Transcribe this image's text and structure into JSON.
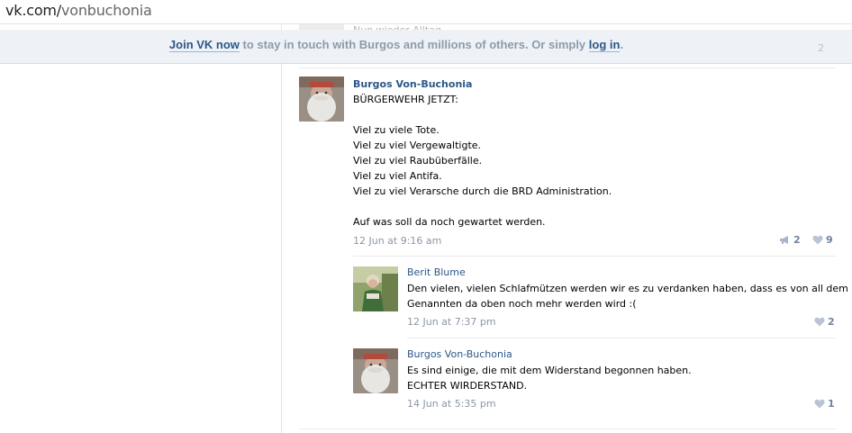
{
  "browser": {
    "url_host": "vk.com/",
    "url_path": "vonbuchonia"
  },
  "ghost_text": "Nun wieder Alltag.",
  "banner": {
    "join_label": "Join VK now",
    "middle_text": " to stay in touch with Burgos and millions of others. Or simply ",
    "login_label": "log in",
    "end_text": "."
  },
  "post": {
    "author": "Burgos Von-Buchonia",
    "text": "BÜRGERWEHR JETZT:\n\nViel zu viele Tote.\nViel zu viel Vergewaltigte.\nViel zu viel Raubüberfälle.\nViel zu viel Antifa.\nViel zu viel Verarsche durch die BRD Administration.\n\nAuf was soll da noch gewartet werden.",
    "date": "12 Jun at 9:16 am",
    "shares": "2",
    "likes": "9"
  },
  "replies": [
    {
      "author": "Berit Blume",
      "text": "Den vielen, vielen Schlafmützen werden wir es zu verdanken haben, dass es von all dem\nGenannten da oben noch mehr werden wird :(",
      "date": "12 Jun at 7:37 pm",
      "likes": "2"
    },
    {
      "author": "Burgos Von-Buchonia",
      "text": "Es sind einige, die mit dem Widerstand begonnen haben.\nECHTER WIRDERSTAND.",
      "date": "14 Jun at 5:35 pm",
      "likes": "1"
    }
  ],
  "icons": {
    "share": "megaphone-icon",
    "like": "heart-icon"
  },
  "colors": {
    "link": "#2b5788",
    "muted": "#8c96a5",
    "banner_bg": "#edf1f6"
  }
}
